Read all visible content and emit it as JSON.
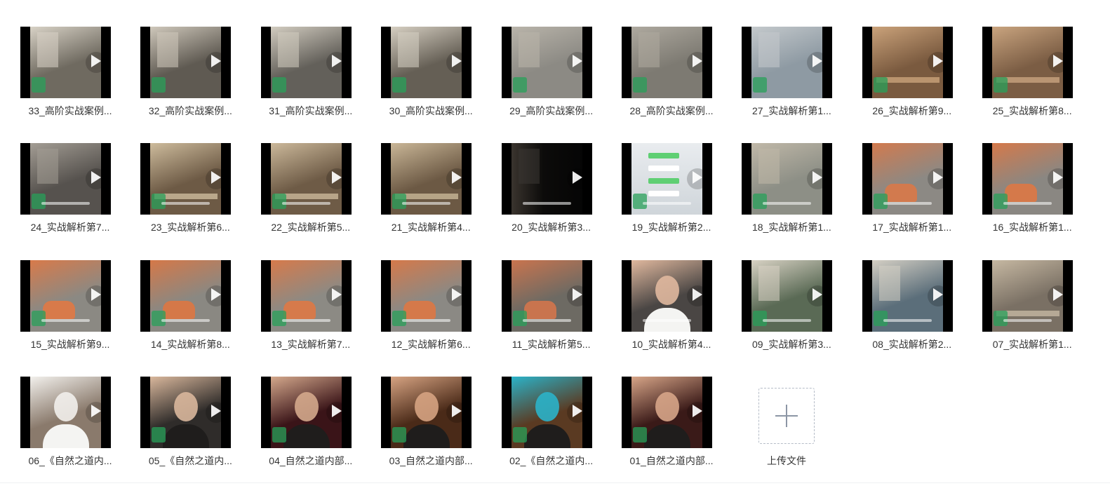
{
  "items": [
    {
      "label": "33_高阶实战案例...",
      "tone": "#6f6a60",
      "accent": "#d8d2c6",
      "kind": "cafe"
    },
    {
      "label": "32_高阶实战案例...",
      "tone": "#5f5a52",
      "accent": "#cfc8bb",
      "kind": "cafe"
    },
    {
      "label": "31_高阶实战案例...",
      "tone": "#63605a",
      "accent": "#d2ccc0",
      "kind": "cafe"
    },
    {
      "label": "30_高阶实战案例...",
      "tone": "#655f55",
      "accent": "#d6cfc2",
      "kind": "cafe"
    },
    {
      "label": "29_高阶实战案例...",
      "tone": "#8c8a84",
      "accent": "#b9b4aa",
      "kind": "mall"
    },
    {
      "label": "28_高阶实战案例...",
      "tone": "#7d7a72",
      "accent": "#aea99f",
      "kind": "mall"
    },
    {
      "label": "27_实战解析第1...",
      "tone": "#8e9aa3",
      "accent": "#c4c9cc",
      "kind": "street"
    },
    {
      "label": "26_实战解析第9...",
      "tone": "#7a5a3f",
      "accent": "#caa27a",
      "kind": "table"
    },
    {
      "label": "25_实战解析第8...",
      "tone": "#7b5d44",
      "accent": "#c9a47f",
      "kind": "table"
    },
    {
      "label": "24_实战解析第7...",
      "tone": "#56524e",
      "accent": "#a39d94",
      "kind": "cafe"
    },
    {
      "label": "23_实战解析第6...",
      "tone": "#6d5a45",
      "accent": "#cdbb9c",
      "kind": "table"
    },
    {
      "label": "22_实战解析第5...",
      "tone": "#6e5b46",
      "accent": "#cbb89a",
      "kind": "table"
    },
    {
      "label": "21_实战解析第4...",
      "tone": "#6c5944",
      "accent": "#c9b697",
      "kind": "table"
    },
    {
      "label": "20_实战解析第3...",
      "tone": "#1e1c1a",
      "accent": "#3b3733",
      "kind": "dark"
    },
    {
      "label": "19_实战解析第2...",
      "tone": "#dfe3e6",
      "accent": "#5fcf73",
      "kind": "chat"
    },
    {
      "label": "18_实战解析第1...",
      "tone": "#8d8f86",
      "accent": "#c0b8a8",
      "kind": "street"
    },
    {
      "label": "17_实战解析第1...",
      "tone": "#8c8984",
      "accent": "#d27a4e",
      "kind": "chairs"
    },
    {
      "label": "16_实战解析第1...",
      "tone": "#8a8782",
      "accent": "#d5794a",
      "kind": "chairs"
    },
    {
      "label": "15_实战解析第9...",
      "tone": "#8b8983",
      "accent": "#d87a4a",
      "kind": "chairs"
    },
    {
      "label": "14_实战解析第8...",
      "tone": "#8a8882",
      "accent": "#d57848",
      "kind": "chairs"
    },
    {
      "label": "13_实战解析第7...",
      "tone": "#8c8a84",
      "accent": "#d67a4b",
      "kind": "chairs"
    },
    {
      "label": "12_实战解析第6...",
      "tone": "#8b8984",
      "accent": "#d5794a",
      "kind": "chairs"
    },
    {
      "label": "11_实战解析第5...",
      "tone": "#6d6a63",
      "accent": "#c9744e",
      "kind": "chairs"
    },
    {
      "label": "10_实战解析第4...",
      "tone": "#4a4644",
      "accent": "#e0b89e",
      "kind": "face"
    },
    {
      "label": "09_实战解析第3...",
      "tone": "#5a6a55",
      "accent": "#d8d2c4",
      "kind": "street"
    },
    {
      "label": "08_实战解析第2...",
      "tone": "#5b6e7a",
      "accent": "#d4cfc4",
      "kind": "street"
    },
    {
      "label": "07_实战解析第1...",
      "tone": "#7a7064",
      "accent": "#c6b8a2",
      "kind": "table"
    },
    {
      "label": "06_《自然之道内...",
      "tone": "#8a7a6c",
      "accent": "#f2f0ec",
      "kind": "face"
    },
    {
      "label": "05_《自然之道内...",
      "tone": "#2f2c2a",
      "accent": "#d9b79c",
      "kind": "studio"
    },
    {
      "label": "04_自然之道内部...",
      "tone": "#3a1418",
      "accent": "#d4a88c",
      "kind": "studio"
    },
    {
      "label": "03_自然之道内部...",
      "tone": "#4a2a18",
      "accent": "#d6a382",
      "kind": "studio"
    },
    {
      "label": "02_《自然之道内...",
      "tone": "#5a3a22",
      "accent": "#2bb3c9",
      "kind": "studio"
    },
    {
      "label": "01_自然之道内部...",
      "tone": "#3a1a18",
      "accent": "#d7a588",
      "kind": "studio"
    }
  ],
  "upload": {
    "label": "上传文件"
  }
}
